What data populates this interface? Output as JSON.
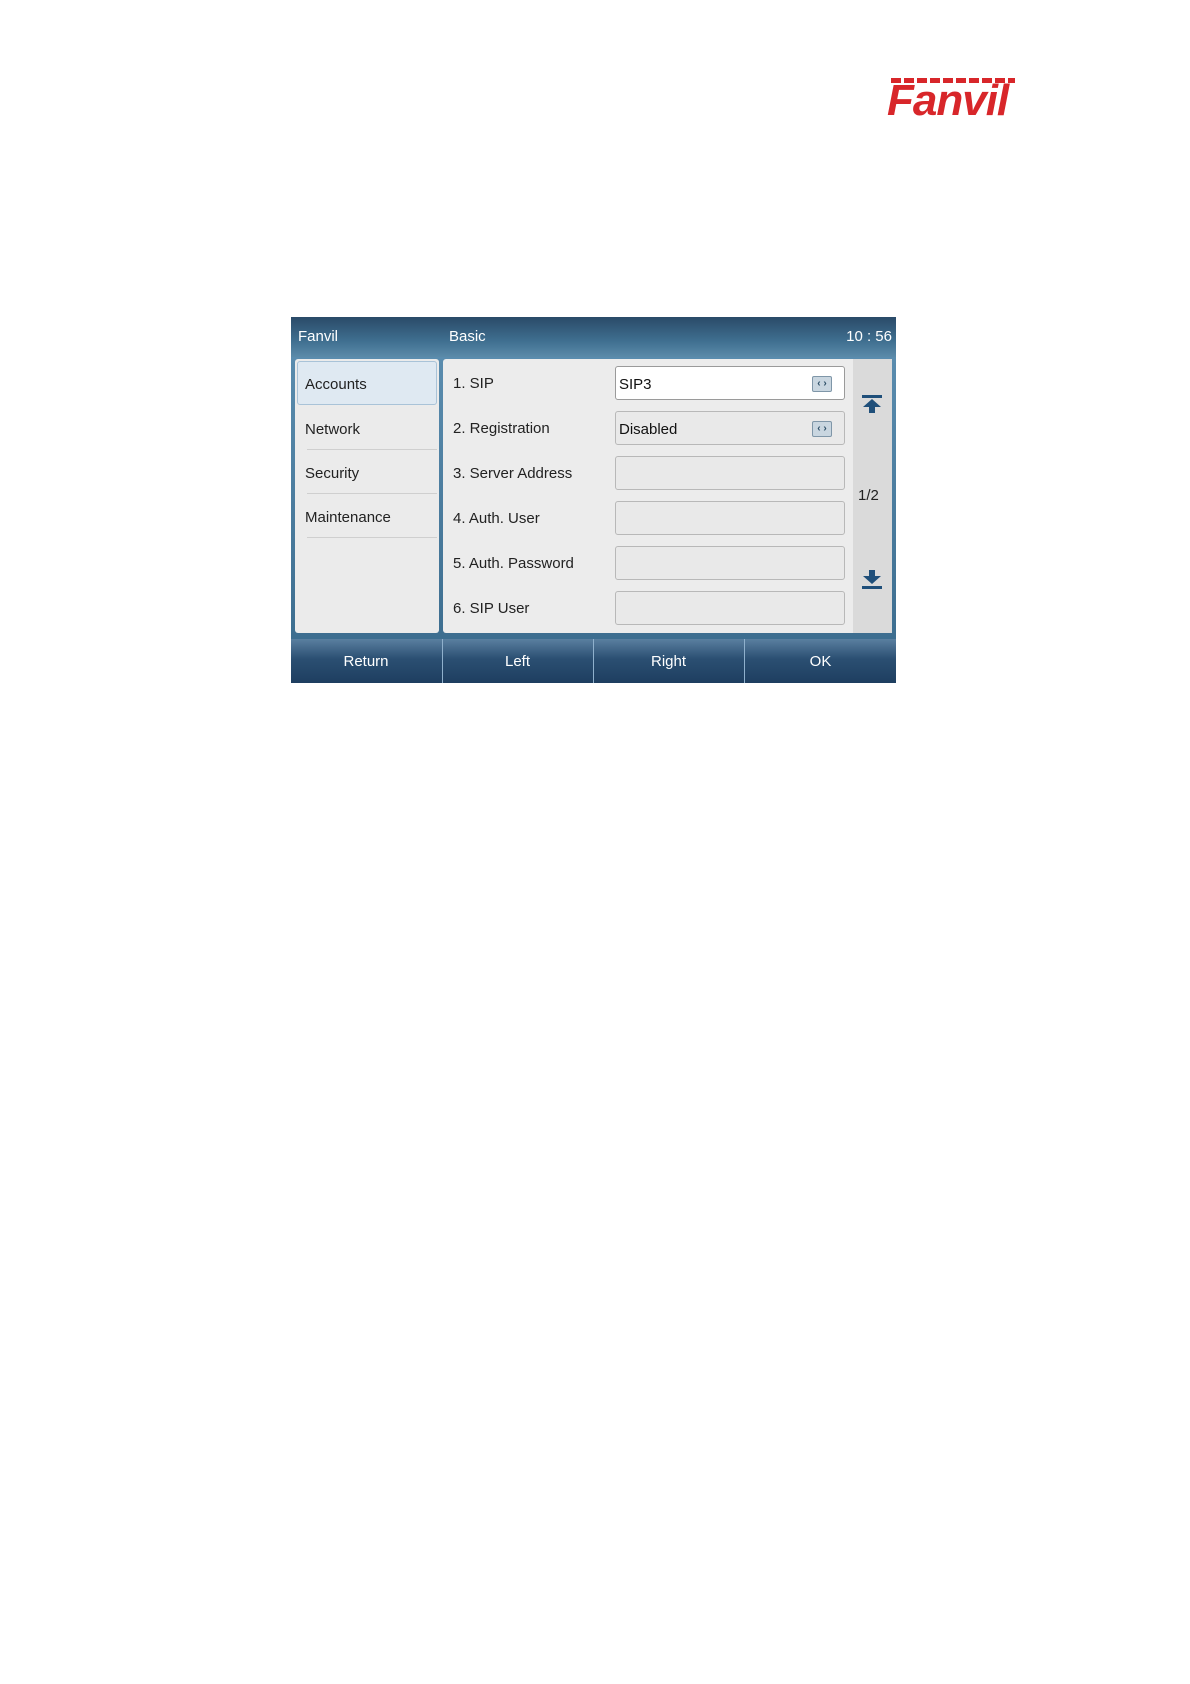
{
  "logo": {
    "text": "Fanvil"
  },
  "topbar": {
    "brand": "Fanvil",
    "title": "Basic",
    "time": "10 : 56"
  },
  "sidebar": {
    "items": [
      {
        "label": "Accounts",
        "active": true
      },
      {
        "label": "Network",
        "active": false
      },
      {
        "label": "Security",
        "active": false
      },
      {
        "label": "Maintenance",
        "active": false
      }
    ]
  },
  "form": {
    "rows": [
      {
        "label": "1.  SIP",
        "value": "SIP3",
        "type": "select"
      },
      {
        "label": "2.  Registration",
        "value": "Disabled",
        "type": "select"
      },
      {
        "label": "3.  Server Address",
        "value": "",
        "type": "text"
      },
      {
        "label": "4.  Auth. User",
        "value": "",
        "type": "text"
      },
      {
        "label": "5.  Auth. Password",
        "value": "",
        "type": "text"
      },
      {
        "label": "6.  SIP User",
        "value": "",
        "type": "text"
      }
    ]
  },
  "pager": {
    "page": "1/2",
    "up_icon": "page-up-icon",
    "down_icon": "page-down-icon"
  },
  "softkeys": {
    "return": "Return",
    "left": "Left",
    "right": "Right",
    "ok": "OK"
  },
  "colors": {
    "brand_red": "#d8262a",
    "bar_blue": "#2b4f72",
    "panel_bg": "#ececec"
  }
}
